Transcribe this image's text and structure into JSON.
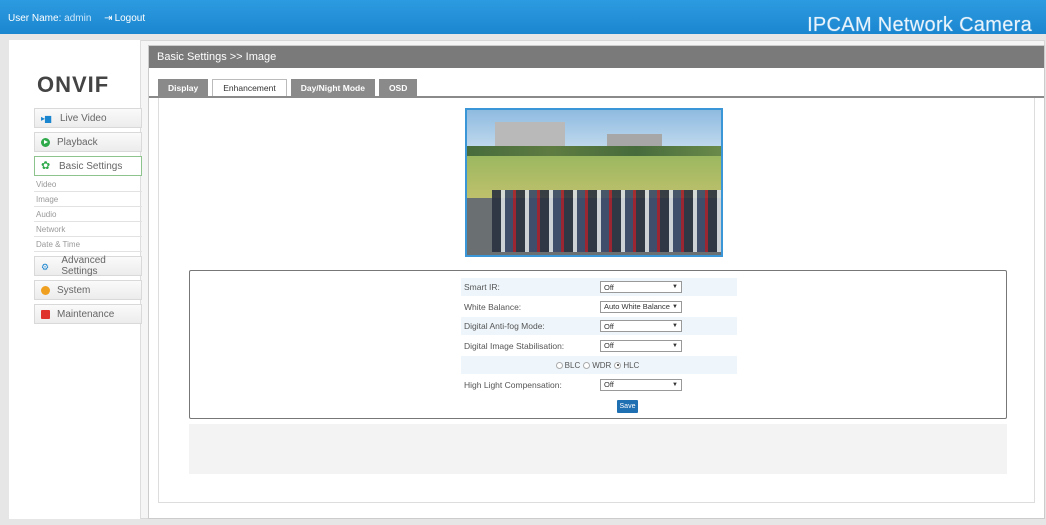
{
  "topbar": {
    "user_label": "User Name:",
    "user_name": "admin",
    "logout_arrow": "⇥",
    "logout_label": "Logout",
    "brand": "IPCAM Network Camera"
  },
  "logo": {
    "text": "ONVIF"
  },
  "sidebar": {
    "items": [
      {
        "label": "Live Video",
        "icon": "live-video-icon"
      },
      {
        "label": "Playback",
        "icon": "playback-icon"
      },
      {
        "label": "Basic Settings",
        "icon": "gear-icon"
      },
      {
        "label": "Advanced Settings",
        "icon": "advanced-settings-icon"
      },
      {
        "label": "System",
        "icon": "system-icon"
      },
      {
        "label": "Maintenance",
        "icon": "maintenance-icon"
      }
    ],
    "submenu": [
      "Video",
      "Image",
      "Audio",
      "Network",
      "Date & Time"
    ]
  },
  "main": {
    "breadcrumb": "Basic Settings >> Image",
    "tabs": [
      "Display",
      "Enhancement",
      "Day/Night Mode",
      "OSD"
    ],
    "active_tab": "Enhancement"
  },
  "form": {
    "smart_ir": {
      "label": "Smart IR:",
      "value": "Off"
    },
    "white_balance": {
      "label": "White Balance:",
      "value": "Auto White Balance"
    },
    "antifog": {
      "label": "Digital Anti-fog Mode:",
      "value": "Off"
    },
    "stabilisation": {
      "label": "Digital Image Stabilisation:",
      "value": "Off"
    },
    "mode_options": [
      "BLC",
      "WDR",
      "HLC"
    ],
    "mode_selected": "HLC",
    "hlc": {
      "label": "High Light Compensation:",
      "value": "Off"
    },
    "save_label": "Save"
  },
  "colors": {
    "topbar": "#1b86d0",
    "header": "#7a7a7a",
    "save": "#1f6fb3",
    "active_border": "#8dc48d"
  }
}
